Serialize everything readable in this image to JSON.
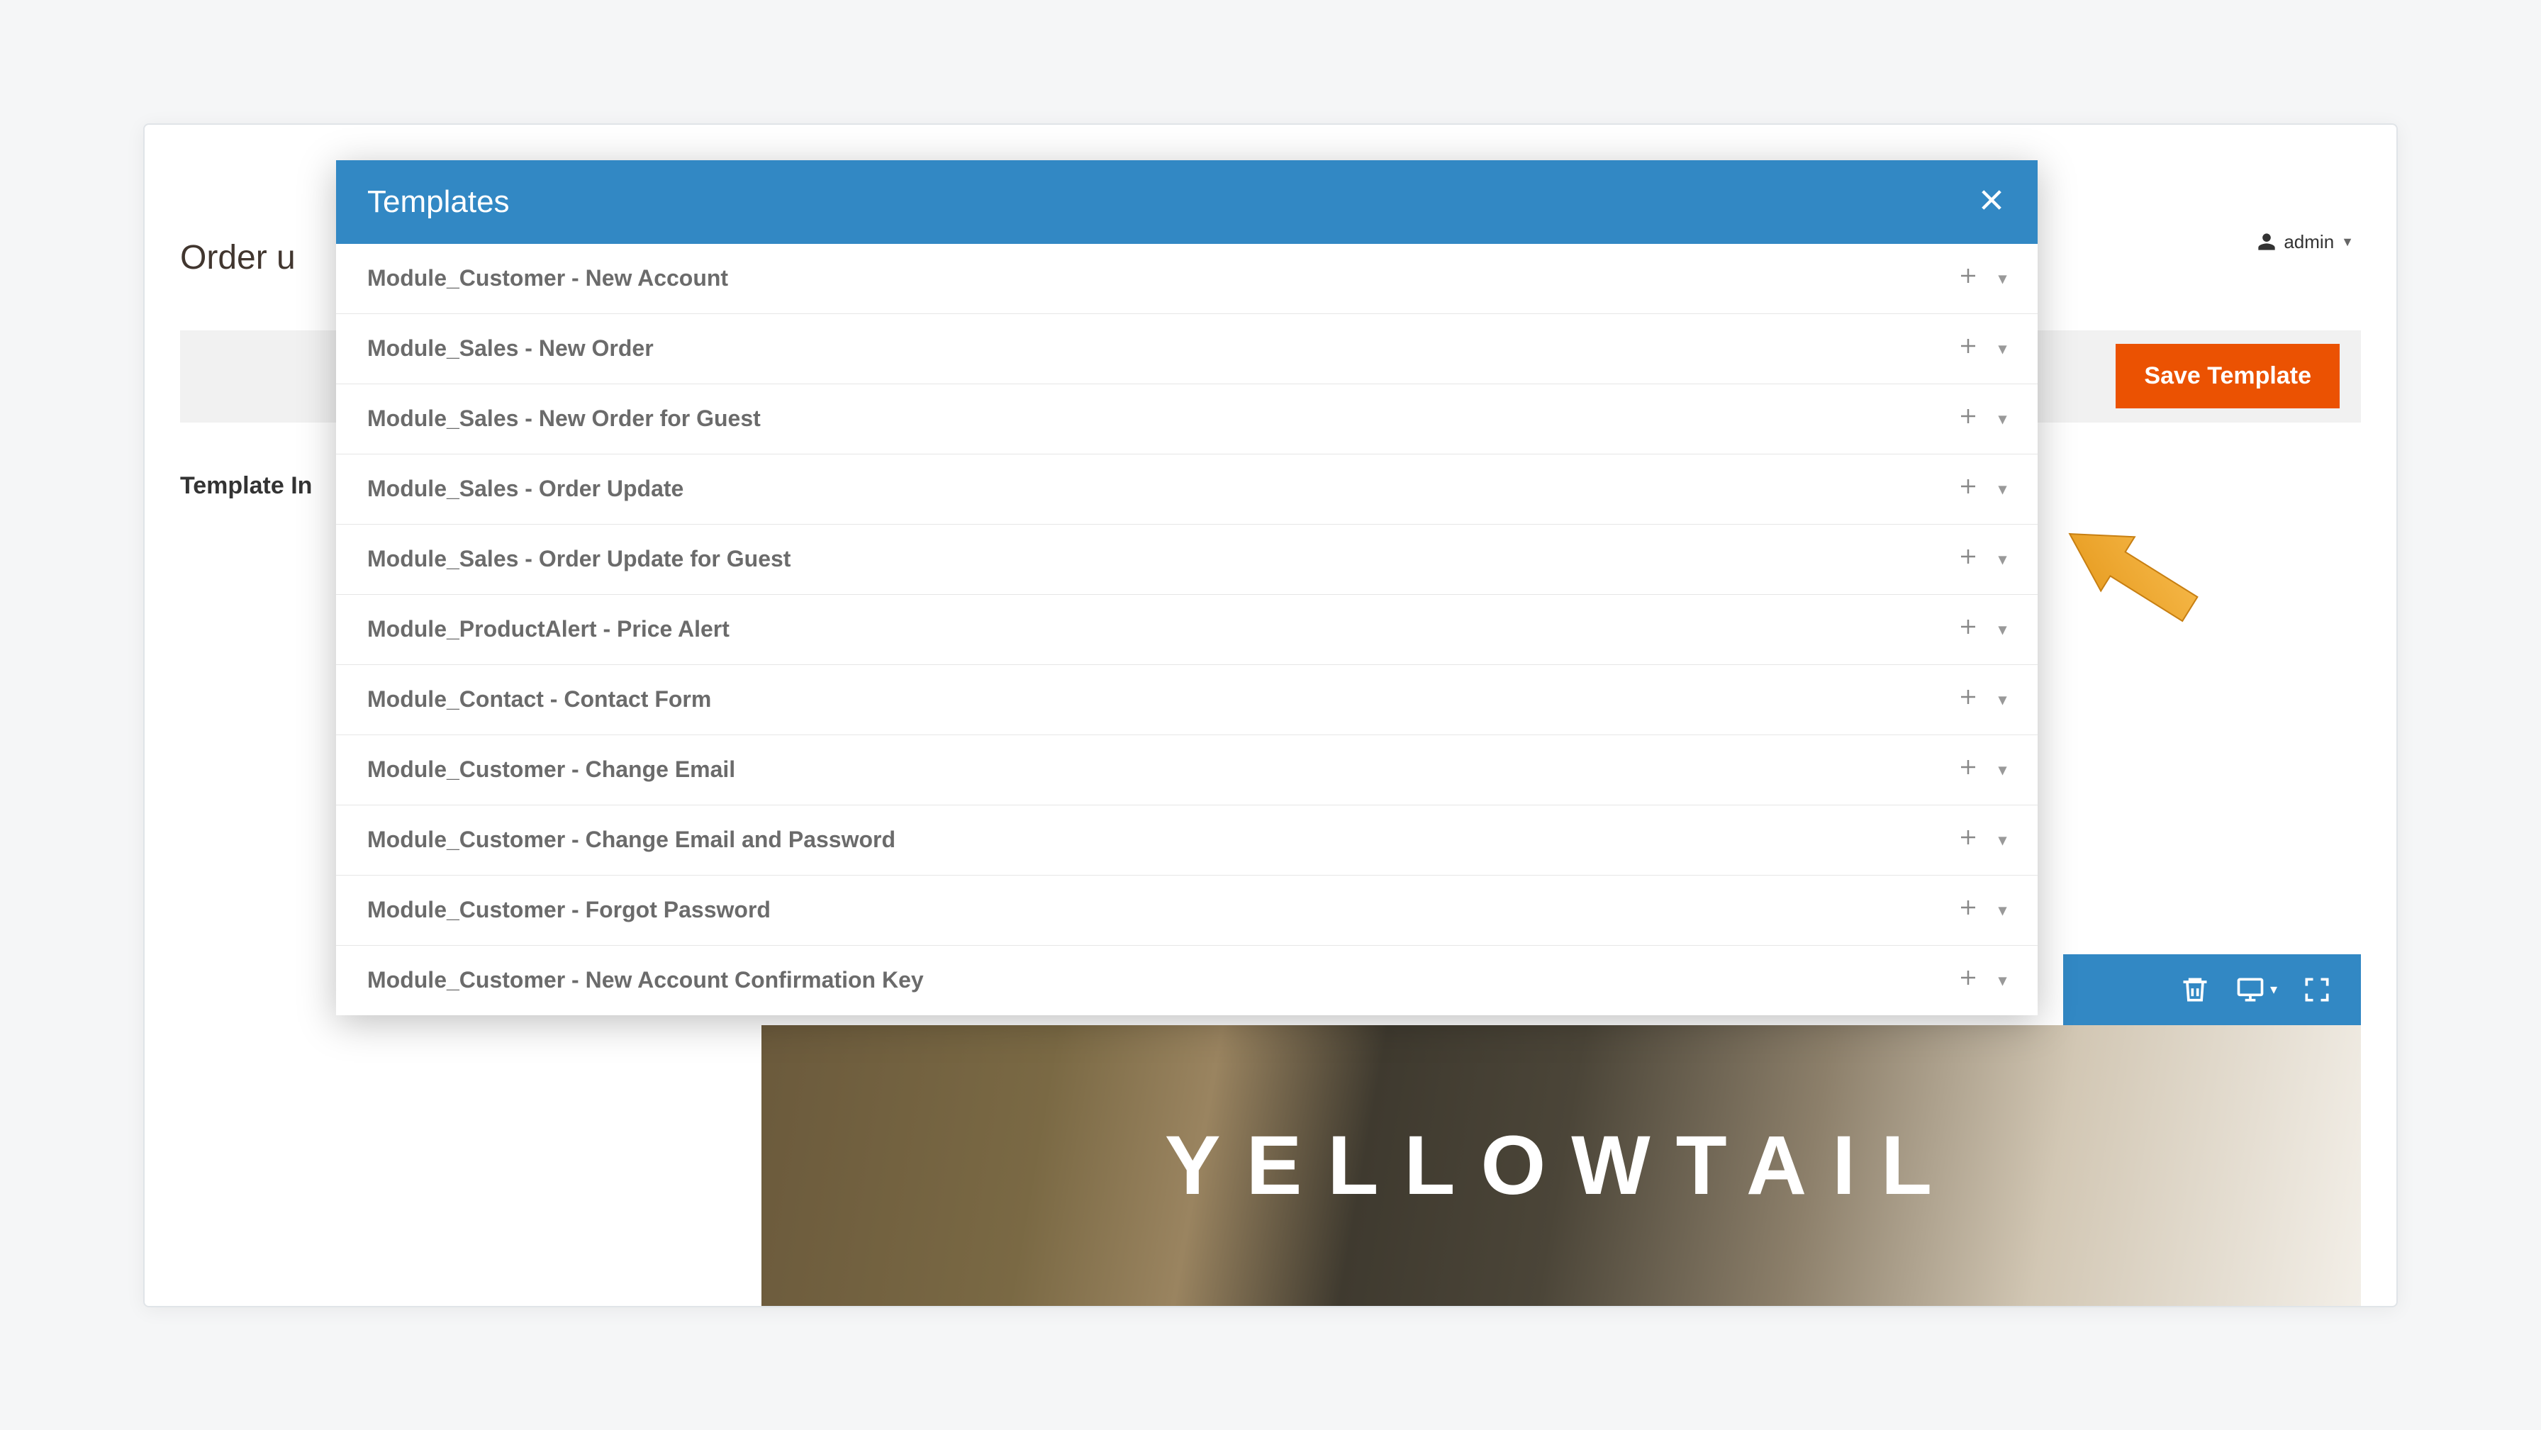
{
  "page": {
    "title_partial": "Order u",
    "section_label": "Template In"
  },
  "user": {
    "name": "admin"
  },
  "toolbar": {
    "save_label": "Save Template"
  },
  "hero": {
    "text": "YELLOWTAIL"
  },
  "modal": {
    "title": "Templates",
    "items": [
      {
        "label": "Module_Customer - New Account"
      },
      {
        "label": "Module_Sales - New Order"
      },
      {
        "label": "Module_Sales - New Order for Guest"
      },
      {
        "label": "Module_Sales - Order Update"
      },
      {
        "label": "Module_Sales - Order Update for Guest"
      },
      {
        "label": "Module_ProductAlert - Price Alert"
      },
      {
        "label": "Module_Contact - Contact Form"
      },
      {
        "label": "Module_Customer - Change Email"
      },
      {
        "label": "Module_Customer - Change Email and Password"
      },
      {
        "label": "Module_Customer - Forgot Password"
      },
      {
        "label": "Module_Customer - New Account Confirmation Key"
      }
    ]
  }
}
